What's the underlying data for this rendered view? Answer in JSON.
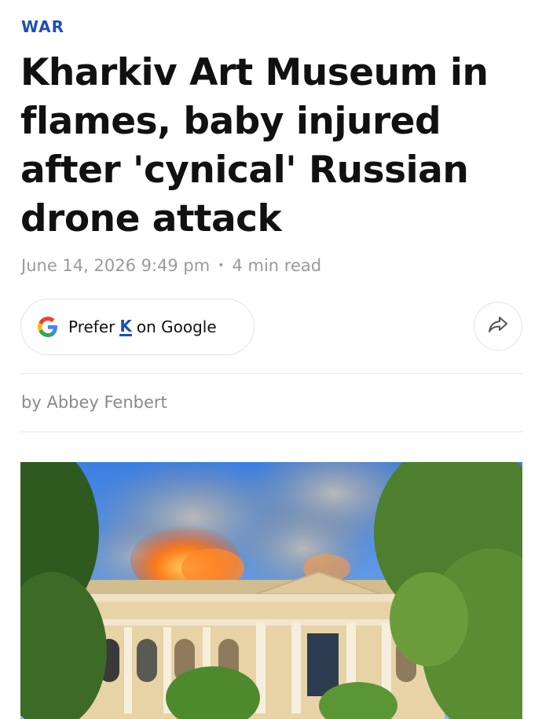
{
  "article": {
    "category": "WAR",
    "headline": "Kharkiv Art Museum in flames, baby injured after 'cynical' Russian drone attack",
    "date": "June 14, 2026 9:49 pm",
    "separator": "•",
    "read_time": "4 min read",
    "byline_prefix": "by",
    "author": "Abbey Fenbert"
  },
  "actions": {
    "prefer_text_before": "Prefer",
    "prefer_brand": "K",
    "prefer_text_after": "on Google",
    "prefer_icon": "google-g-icon",
    "share_icon": "share-arrow-icon"
  },
  "colors": {
    "accent": "#1f4fb5",
    "meta_text": "#9a9a9a",
    "headline": "#111111"
  }
}
